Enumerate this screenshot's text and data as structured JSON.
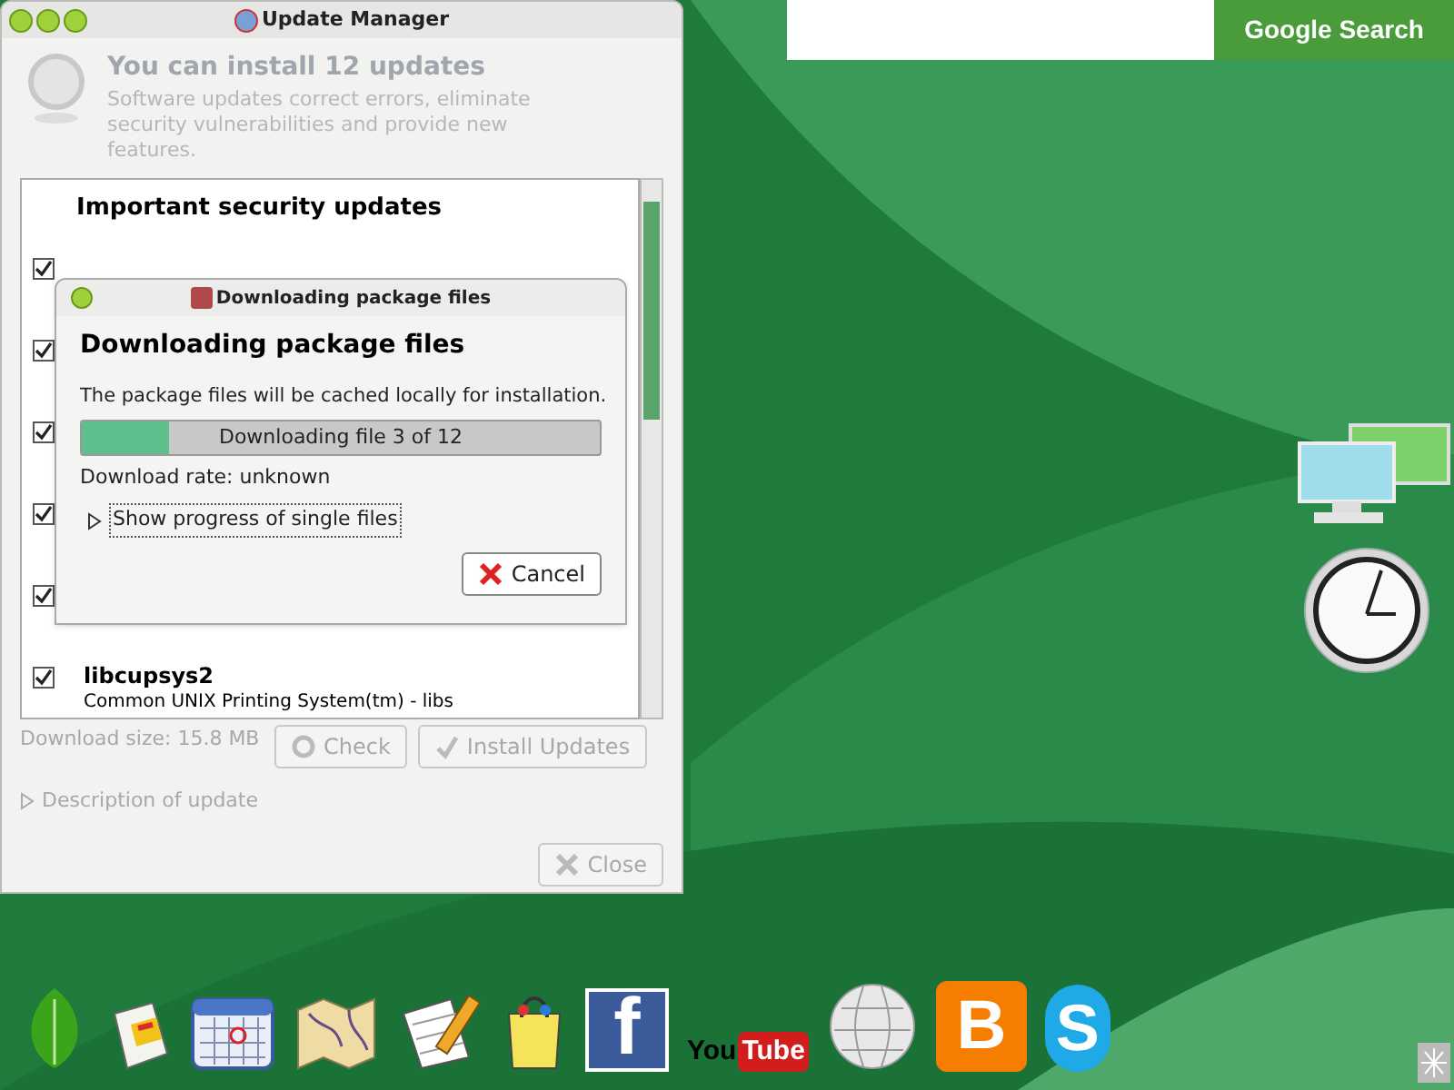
{
  "desktop": {
    "search": {
      "button": "Google Search"
    }
  },
  "update_manager": {
    "title": "Update Manager",
    "heading": "You can install 12 updates",
    "description": "Software updates correct errors, eliminate security vulnerabilities and provide new features.",
    "list": {
      "section": "Important security updates",
      "rows": [
        {
          "checked": true
        },
        {
          "checked": true
        },
        {
          "checked": true
        },
        {
          "checked": true
        },
        {
          "checked": true
        },
        {
          "name": "libcupsys2",
          "summary": "Common UNIX Printing System(tm) - libs",
          "checked": true
        }
      ]
    },
    "download_size": "Download size: 15.8 MB",
    "buttons": [
      {
        "kind": "refresh",
        "label": "Check"
      },
      {
        "kind": "install",
        "label": "Install Updates"
      }
    ],
    "expander": "Description of update",
    "close": "Close"
  },
  "dialog": {
    "title": "Downloading package files",
    "heading": "Downloading package files",
    "text": "The package files will be cached locally for installation.",
    "progress": {
      "level": 0.17,
      "text": "Downloading file 3 of 12"
    },
    "rate": "Download rate: unknown",
    "expander": "Show progress of single files",
    "cancel": "Cancel"
  },
  "dock": [
    {
      "kind": "leaf"
    },
    {
      "kind": "news"
    },
    {
      "kind": "calendar"
    },
    {
      "kind": "map"
    },
    {
      "kind": "sheet"
    },
    {
      "kind": "bag"
    },
    {
      "kind": "facebook",
      "text": "f"
    },
    {
      "kind": "youtube",
      "text": "You",
      "text2": "Tube"
    },
    {
      "kind": "wiki"
    },
    {
      "kind": "blogger",
      "text": "B"
    },
    {
      "kind": "skype",
      "text": "S"
    }
  ]
}
